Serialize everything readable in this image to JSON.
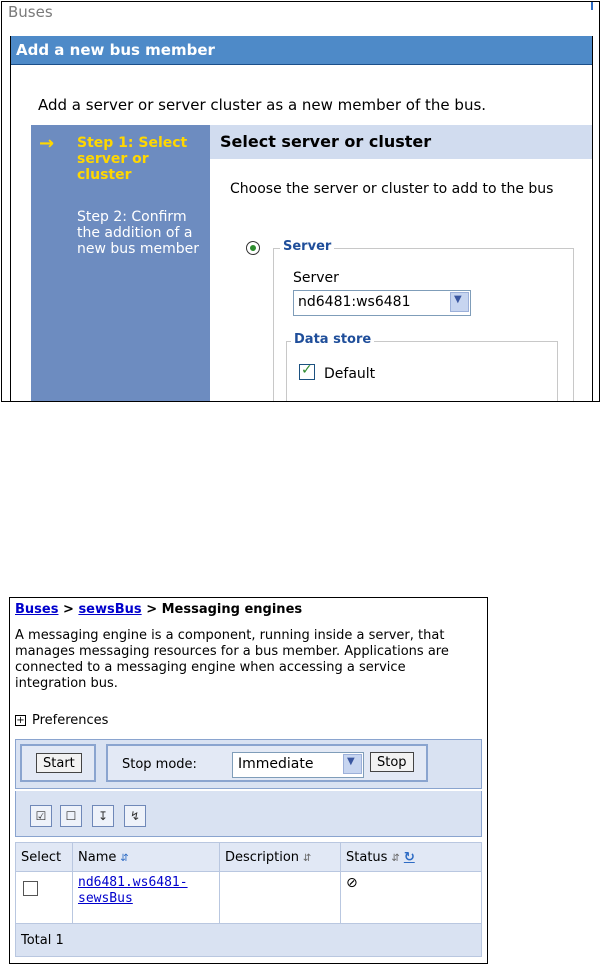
{
  "panel1": {
    "title": "Buses",
    "header": "Add a new bus member",
    "description": "Add a server or server cluster as a new member of the bus.",
    "wizard": {
      "step1": "Step 1: Select server or cluster",
      "step2": "Step 2: Confirm the addition of a new bus member"
    },
    "main": {
      "heading": "Select server or cluster",
      "choose_text": "Choose the server or cluster to add to the bus",
      "server_legend": "Server",
      "server_label": "Server",
      "server_value": "nd6481:ws6481",
      "datastore_legend": "Data store",
      "default_label": "Default"
    }
  },
  "panel2": {
    "breadcrumb": [
      "Buses",
      "sewsBus",
      "Messaging engines"
    ],
    "breadcrumb_sep": ">",
    "description": "A messaging engine is a component, running inside a server, that manages messaging resources for a bus member. Applications are connected to a messaging engine when accessing a service integration bus.",
    "preferences": "Preferences",
    "toolbar": {
      "start": "Start",
      "stop_mode_label": "Stop mode:",
      "stop_mode_value": "Immediate",
      "stop": "Stop"
    },
    "table": {
      "headers": [
        "Select",
        "Name",
        "Description",
        "Status"
      ],
      "rows": [
        {
          "name": "nd6481.ws6481-sewsBus",
          "description": "",
          "status_icon": "stopped-icon"
        }
      ]
    },
    "total": "Total 1"
  },
  "icons": [
    "select-all-icon",
    "deselect-all-icon",
    "filter-icon",
    "clear-filter-icon",
    "refresh-icon"
  ]
}
